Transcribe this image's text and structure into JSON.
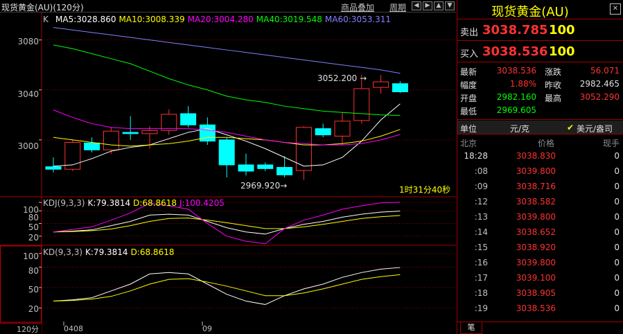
{
  "topbar": {
    "title": "现货黄金(AU)(120分)",
    "overlay_link": "商品叠加",
    "cycle_link": "周期",
    "nav_icons": [
      "left-arrow-icon",
      "right-arrow-icon",
      "up-arrow-icon",
      "down-arrow-icon"
    ]
  },
  "chart": {
    "k_label": "K",
    "ma": [
      {
        "label": "MA5:3028.860",
        "color": "#ffffff"
      },
      {
        "label": "MA10:3008.339",
        "color": "#ffff00"
      },
      {
        "label": "MA20:3004.280",
        "color": "#ff00ff"
      },
      {
        "label": "MA40:3019.548",
        "color": "#00ff00"
      },
      {
        "label": "MA60:3053.311",
        "color": "#8080ff"
      }
    ],
    "high_annotation": "3052.200",
    "low_annotation": "2969.920",
    "countdown": "1时31分40秒",
    "kdj1": {
      "title": "KDJ(9,3,3)",
      "k": "K:79.3814",
      "d": "D:68.8618",
      "j": "J:100.4205"
    },
    "kdj2": {
      "title": "KD(9,3,3)",
      "k": "K:79.3814",
      "d": "D:68.8618"
    },
    "price_axis_labels": [
      "3080",
      "3040",
      "3000"
    ],
    "kdj1_axis_labels": [
      "100",
      "80",
      "50",
      "20"
    ],
    "kdj2_axis_labels": [
      "100",
      "80",
      "50",
      "20"
    ],
    "x_labels": [
      "0408",
      "09"
    ],
    "period": "120分"
  },
  "chart_data": {
    "type": "candlestick",
    "candles": [
      {
        "o": 2978.5,
        "c": 2976.5,
        "h": 2986.0,
        "l": 2974.0
      },
      {
        "o": 2976.5,
        "c": 2998.0,
        "h": 3000.5,
        "l": 2975.0
      },
      {
        "o": 2997.5,
        "c": 2992.0,
        "h": 3002.0,
        "l": 2990.0
      },
      {
        "o": 2992.0,
        "c": 3007.0,
        "h": 3010.0,
        "l": 2989.0
      },
      {
        "o": 3006.0,
        "c": 3005.0,
        "h": 3019.0,
        "l": 3000.0
      },
      {
        "o": 3005.0,
        "c": 3007.5,
        "h": 3011.0,
        "l": 2993.0
      },
      {
        "o": 3007.5,
        "c": 3020.5,
        "h": 3024.5,
        "l": 3004.0
      },
      {
        "o": 3021.0,
        "c": 3012.0,
        "h": 3027.0,
        "l": 3010.0
      },
      {
        "o": 3012.0,
        "c": 2999.0,
        "h": 3018.0,
        "l": 2996.0
      },
      {
        "o": 3000.0,
        "c": 2980.0,
        "h": 3002.0,
        "l": 2970.0
      },
      {
        "o": 2980.0,
        "c": 2975.0,
        "h": 2989.0,
        "l": 2971.5
      },
      {
        "o": 2980.0,
        "c": 2977.0,
        "h": 2982.0,
        "l": 2975.0
      },
      {
        "o": 2978.0,
        "c": 2972.0,
        "h": 2987.0,
        "l": 2969.92
      },
      {
        "o": 2975.5,
        "c": 3010.0,
        "h": 3011.0,
        "l": 2968.0
      },
      {
        "o": 3009.0,
        "c": 3004.0,
        "h": 3013.0,
        "l": 3002.0
      },
      {
        "o": 3003.0,
        "c": 3015.0,
        "h": 3022.0,
        "l": 2996.0
      },
      {
        "o": 3015.5,
        "c": 3041.0,
        "h": 3052.2,
        "l": 3013.0
      },
      {
        "o": 3042.0,
        "c": 3046.5,
        "h": 3052.0,
        "l": 3037.0
      },
      {
        "o": 3045.0,
        "c": 3038.5,
        "h": 3047.0,
        "l": 3037.5
      }
    ],
    "ma_series": [
      {
        "name": "MA5",
        "color": "#ffffff",
        "values": [
          2979,
          2980,
          2985,
          2991,
          2994,
          2996,
          3001,
          3006,
          3009,
          3004,
          2999,
          2993,
          2986,
          2979,
          2980,
          2986,
          2999,
          3016,
          3028.86
        ]
      },
      {
        "name": "MA10",
        "color": "#ffff00",
        "values": [
          3002,
          3000,
          2998,
          2996,
          2995,
          2996,
          2997,
          2999,
          3002,
          3002,
          3001,
          3000,
          2998,
          2996,
          2996,
          2997,
          2999,
          3003,
          3008.34
        ]
      },
      {
        "name": "MA20",
        "color": "#ff00ff",
        "values": [
          3024,
          3018,
          3013,
          3010,
          3009,
          3009,
          3009,
          3009,
          3008,
          3006,
          3003,
          3000,
          2998,
          2997,
          2996,
          2996,
          2997,
          3000,
          3004.28
        ]
      },
      {
        "name": "MA40",
        "color": "#00ff00",
        "values": [
          3076,
          3073,
          3069,
          3065,
          3061,
          3055,
          3049,
          3044,
          3040,
          3035,
          3032,
          3030,
          3027,
          3025,
          3023,
          3022,
          3021,
          3020,
          3019.55
        ]
      },
      {
        "name": "MA60",
        "color": "#8080ff",
        "values": [
          3090,
          3088,
          3086,
          3084,
          3082,
          3080,
          3078,
          3076,
          3074,
          3072,
          3070,
          3068,
          3066,
          3064,
          3062,
          3060,
          3058,
          3056,
          3053.31
        ]
      }
    ],
    "price_ylim": [
      2955,
      3092
    ],
    "kdj": {
      "K": [
        30,
        32,
        35,
        45,
        55,
        70,
        72,
        70,
        55,
        40,
        30,
        25,
        38,
        48,
        55,
        65,
        72,
        77,
        79.38
      ],
      "D": [
        30,
        31,
        33,
        37,
        45,
        55,
        62,
        63,
        58,
        52,
        45,
        38,
        38,
        42,
        48,
        55,
        62,
        66,
        68.86
      ],
      "J": [
        30,
        36,
        42,
        58,
        75,
        98,
        92,
        84,
        50,
        20,
        8,
        2,
        38,
        58,
        70,
        84,
        92,
        99,
        100.42
      ]
    },
    "kdj_ylim": [
      0,
      110
    ]
  },
  "quote": {
    "name": "现货黄金(AU)",
    "sell_label": "卖出",
    "sell_price": "3038.785",
    "sell_vol": "100",
    "buy_label": "买入",
    "buy_price": "3038.536",
    "buy_vol": "100",
    "stats": {
      "latest_label": "最新",
      "latest": "3038.536",
      "change_label": "涨跌",
      "change": "56.071",
      "pct_label": "幅度",
      "pct": "1.88%",
      "prev_label": "昨收",
      "prev": "2982.465",
      "open_label": "开盘",
      "open": "2982.160",
      "high_label": "最高",
      "high": "3052.290",
      "low_label": "最低",
      "low": "2969.605"
    },
    "unit_label": "单位",
    "unit_value": "元/克",
    "currency_option": "美元/盎司",
    "ticks_header": {
      "city": "北京",
      "price": "价格",
      "vol": "现手"
    },
    "ticks": [
      {
        "time": "18:28",
        "price": "3038.830",
        "vol": "0"
      },
      {
        "time": ":08",
        "price": "3039.800",
        "vol": "0"
      },
      {
        "time": ":09",
        "price": "3038.716",
        "vol": "0"
      },
      {
        "time": ":12",
        "price": "3038.582",
        "vol": "0"
      },
      {
        "time": ":13",
        "price": "3039.800",
        "vol": "0"
      },
      {
        "time": ":14",
        "price": "3038.652",
        "vol": "0"
      },
      {
        "time": ":15",
        "price": "3038.920",
        "vol": "0"
      },
      {
        "time": ":16",
        "price": "3039.800",
        "vol": "0"
      },
      {
        "time": ":17",
        "price": "3039.100",
        "vol": "0"
      },
      {
        "time": ":18",
        "price": "3038.905",
        "vol": "0"
      },
      {
        "time": ":19",
        "price": "3038.536",
        "vol": "0"
      }
    ],
    "footer_tab": "笔"
  },
  "colors": {
    "up": "#ff3232",
    "down": "#00ffff",
    "grid": "#a00000"
  }
}
